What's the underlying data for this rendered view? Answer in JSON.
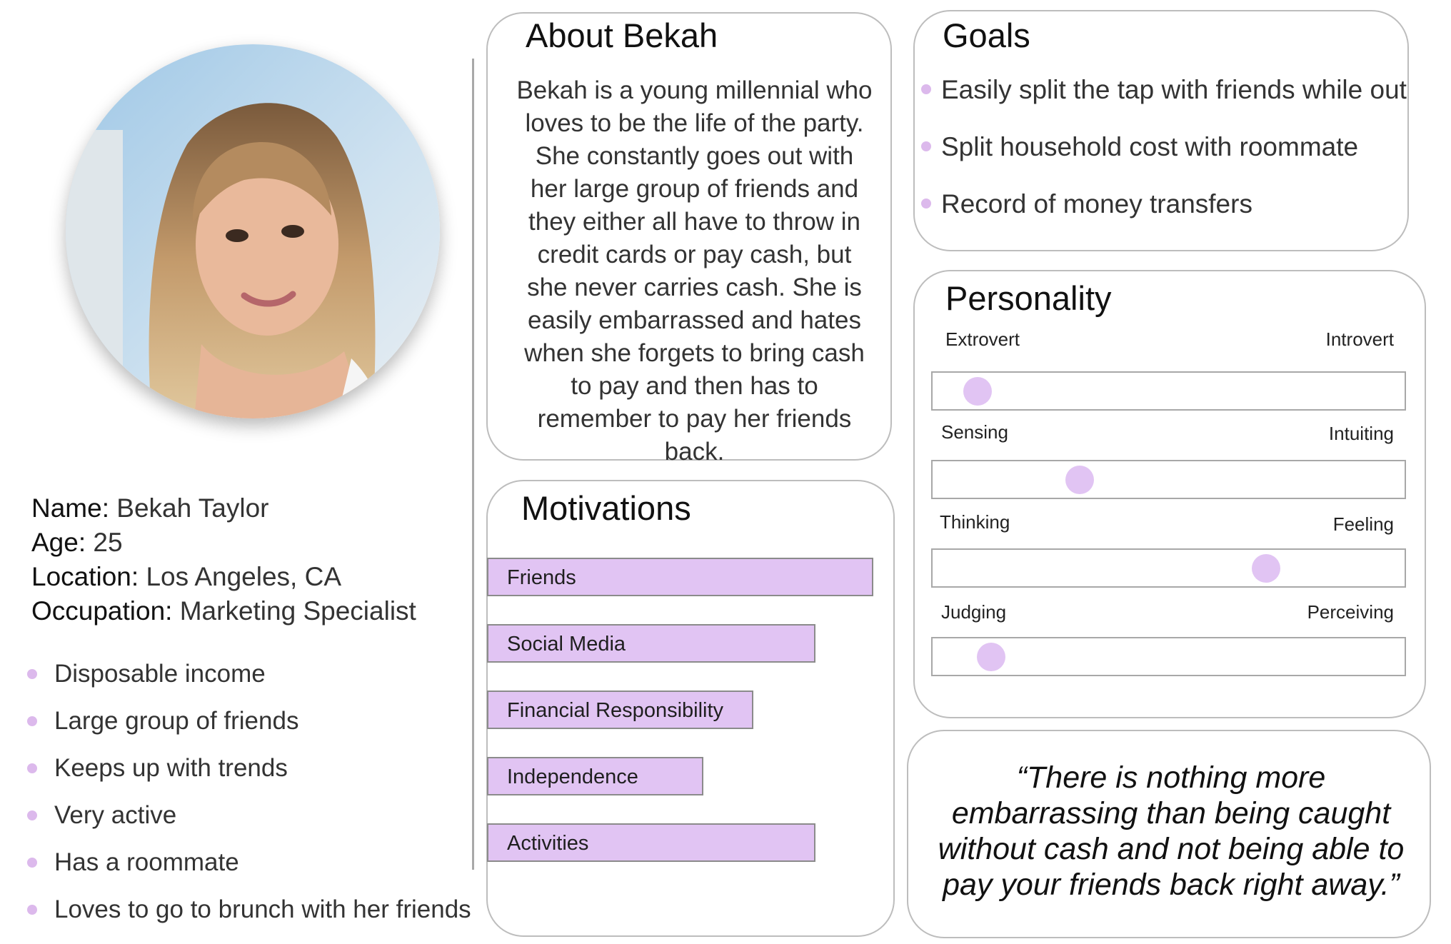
{
  "persona": {
    "name_label": "Name:",
    "name": "Bekah Taylor",
    "age_label": "Age:",
    "age": "25",
    "location_label": "Location:",
    "location": "Los Angeles, CA",
    "occupation_label": "Occupation:",
    "occupation": "Marketing Specialist",
    "traits": [
      "Disposable income",
      "Large group of friends",
      "Keeps up with trends",
      "Very active",
      "Has a roommate",
      "Loves to go to brunch with her friends"
    ]
  },
  "about": {
    "title": "About Bekah",
    "text": "Bekah is a young millennial who loves to be the life of the party. She constantly goes out with her large group of friends and they either all have to throw in credit cards or pay cash, but she never carries cash. She is easily embarrassed and hates when she forgets to bring cash to pay and then has to remember to pay her friends back."
  },
  "motivations": {
    "title": "Motivations",
    "items": [
      {
        "label": "Friends",
        "level": 1.0
      },
      {
        "label": "Social Media",
        "level": 0.85
      },
      {
        "label": "Financial Responsibility",
        "level": 0.69
      },
      {
        "label": "Independence",
        "level": 0.56
      },
      {
        "label": "Activities",
        "level": 0.85
      }
    ]
  },
  "goals": {
    "title": "Goals",
    "items": [
      "Easily split the tap with friends while out",
      "Split household cost with roommate",
      "Record of money transfers"
    ]
  },
  "personality": {
    "title": "Personality",
    "scales": [
      {
        "left": "Extrovert",
        "right": "Introvert",
        "value": 0.07
      },
      {
        "left": "Sensing",
        "right": "Intuiting",
        "value": 0.3
      },
      {
        "left": "Thinking",
        "right": "Feeling",
        "value": 0.72
      },
      {
        "left": "Judging",
        "right": "Perceiving",
        "value": 0.1
      }
    ]
  },
  "quote": {
    "text": "“There is nothing more embarrassing than being caught without cash and not being able to pay your friends back right away.”"
  },
  "colors": {
    "accent": "#e1c4f3",
    "bullet": "#dcb9ec",
    "card_border": "#bdbdbd"
  }
}
